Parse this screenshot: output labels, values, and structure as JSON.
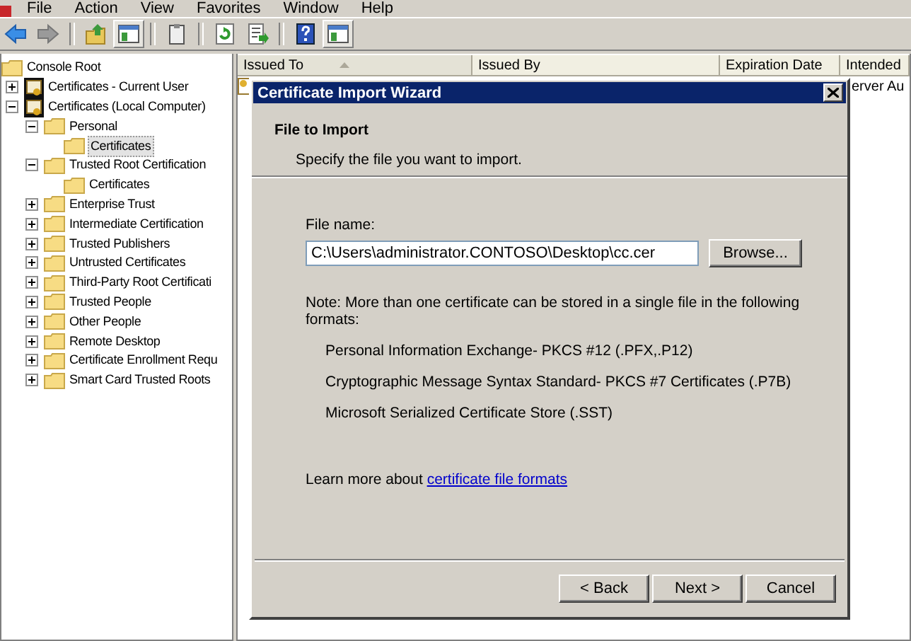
{
  "menu": [
    "File",
    "Action",
    "View",
    "Favorites",
    "Window",
    "Help"
  ],
  "toolbar": [
    {
      "kind": "back"
    },
    {
      "kind": "forward"
    },
    {
      "kind": "sep"
    },
    {
      "kind": "up"
    },
    {
      "kind": "pane"
    },
    {
      "kind": "sep"
    },
    {
      "kind": "clipboard"
    },
    {
      "kind": "sep"
    },
    {
      "kind": "refresh"
    },
    {
      "kind": "export"
    },
    {
      "kind": "sep"
    },
    {
      "kind": "help"
    },
    {
      "kind": "pane"
    }
  ],
  "tree": [
    {
      "label": "Console Root",
      "kind": "folder",
      "selected": false,
      "children": [
        {
          "label": "Certificates - Current User",
          "kind": "store",
          "expanded": false,
          "selected": false
        },
        {
          "label": "Certificates (Local Computer)",
          "kind": "store",
          "expanded": true,
          "selected": false,
          "children": [
            {
              "label": "Personal",
              "kind": "folder",
              "expanded": true,
              "selected": false,
              "children": [
                {
                  "label": "Certificates",
                  "kind": "folder",
                  "selected": true
                }
              ]
            },
            {
              "label": "Trusted Root Certification",
              "kind": "folder",
              "expanded": true,
              "selected": false,
              "children": [
                {
                  "label": "Certificates",
                  "kind": "folder",
                  "selected": false
                }
              ]
            },
            {
              "label": "Enterprise Trust",
              "kind": "folder",
              "expanded": false,
              "selected": false
            },
            {
              "label": "Intermediate Certification",
              "kind": "folder",
              "expanded": false,
              "selected": false
            },
            {
              "label": "Trusted Publishers",
              "kind": "folder",
              "expanded": false,
              "selected": false
            },
            {
              "label": "Untrusted Certificates",
              "kind": "folder",
              "expanded": false,
              "selected": false
            },
            {
              "label": "Third-Party Root Certificati",
              "kind": "folder",
              "expanded": false,
              "selected": false
            },
            {
              "label": "Trusted People",
              "kind": "folder",
              "expanded": false,
              "selected": false
            },
            {
              "label": "Other People",
              "kind": "folder",
              "expanded": false,
              "selected": false
            },
            {
              "label": "Remote Desktop",
              "kind": "folder",
              "expanded": false,
              "selected": false
            },
            {
              "label": "Certificate Enrollment Requ",
              "kind": "folder",
              "expanded": false,
              "selected": false
            },
            {
              "label": "Smart Card Trusted Roots",
              "kind": "folder",
              "expanded": false,
              "selected": false
            }
          ]
        }
      ]
    }
  ],
  "list": {
    "columns": [
      {
        "label": "Issued To",
        "sorted": true
      },
      {
        "label": "Issued By",
        "sorted": false
      },
      {
        "label": "Expiration Date",
        "sorted": false
      },
      {
        "label": "Intended",
        "sorted": false
      }
    ],
    "rows": [
      {
        "column_4": "erver Au"
      }
    ]
  },
  "dialog": {
    "title": "Certificate Import Wizard",
    "heading": "File to Import",
    "subheading": "Specify the file you want to import.",
    "field_label": "File name:",
    "field_value": "C:\\Users\\administrator.CONTOSO\\Desktop\\cc.cer",
    "browse": "Browse...",
    "note": "Note:  More than one certificate can be stored in a single file in the following formats:",
    "formats": [
      "Personal Information Exchange- PKCS #12 (.PFX,.P12)",
      "Cryptographic Message Syntax Standard- PKCS #7 Certificates (.P7B)",
      "Microsoft Serialized Certificate Store (.SST)"
    ],
    "learn_text": "Learn more about",
    "learn_link": "certificate file formats",
    "buttons": [
      "< Back",
      "Next >",
      "Cancel"
    ]
  }
}
